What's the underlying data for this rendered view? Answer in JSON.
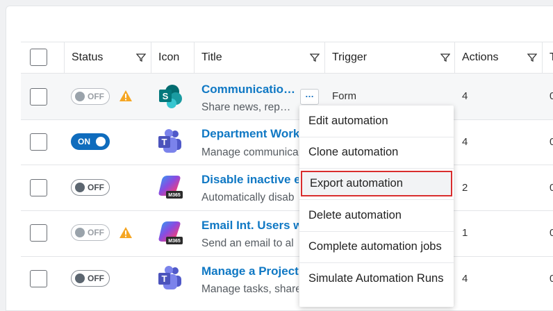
{
  "table": {
    "headers": {
      "status": "Status",
      "icon": "Icon",
      "title": "Title",
      "trigger": "Trigger",
      "actions": "Actions",
      "next": "T"
    },
    "rows": [
      {
        "status": "OFF",
        "status_state": "off-disabled",
        "warning": true,
        "app_icon": "sharepoint-icon",
        "title": "Communicatio…",
        "description": "Share news, rep…",
        "trigger": "Form",
        "actions": "4",
        "next": "0"
      },
      {
        "status": "ON",
        "status_state": "on",
        "warning": false,
        "app_icon": "teams-icon",
        "title": "Department Work",
        "description": "Manage communica",
        "trigger": "",
        "actions": "4",
        "next": "0"
      },
      {
        "status": "OFF",
        "status_state": "off",
        "warning": false,
        "app_icon": "m365-copilot-icon",
        "title": "Disable inactive e",
        "description": "Automatically disab",
        "trigger": "",
        "actions": "2",
        "next": "0"
      },
      {
        "status": "OFF",
        "status_state": "off-disabled",
        "warning": true,
        "app_icon": "m365-copilot-icon",
        "title": "Email Int. Users w",
        "description": "Send an email to al",
        "trigger": "",
        "actions": "1",
        "next": "0"
      },
      {
        "status": "OFF",
        "status_state": "off",
        "warning": false,
        "app_icon": "teams-icon",
        "title": "Manage a Project",
        "description": "Manage tasks, share",
        "trigger": "",
        "actions": "4",
        "next": "0"
      }
    ],
    "more_button": "…",
    "badge_m365": "M365"
  },
  "context_menu": {
    "items": [
      "Edit automation",
      "Clone automation",
      "Export automation",
      "Delete automation",
      "Complete automation jobs",
      "Simulate Automation Runs"
    ],
    "highlighted_index": 2
  },
  "colors": {
    "link": "#0f78c4",
    "toggle_on": "#0f6cbd",
    "warning": "#f5a623",
    "highlight_border": "#d92d2d"
  }
}
